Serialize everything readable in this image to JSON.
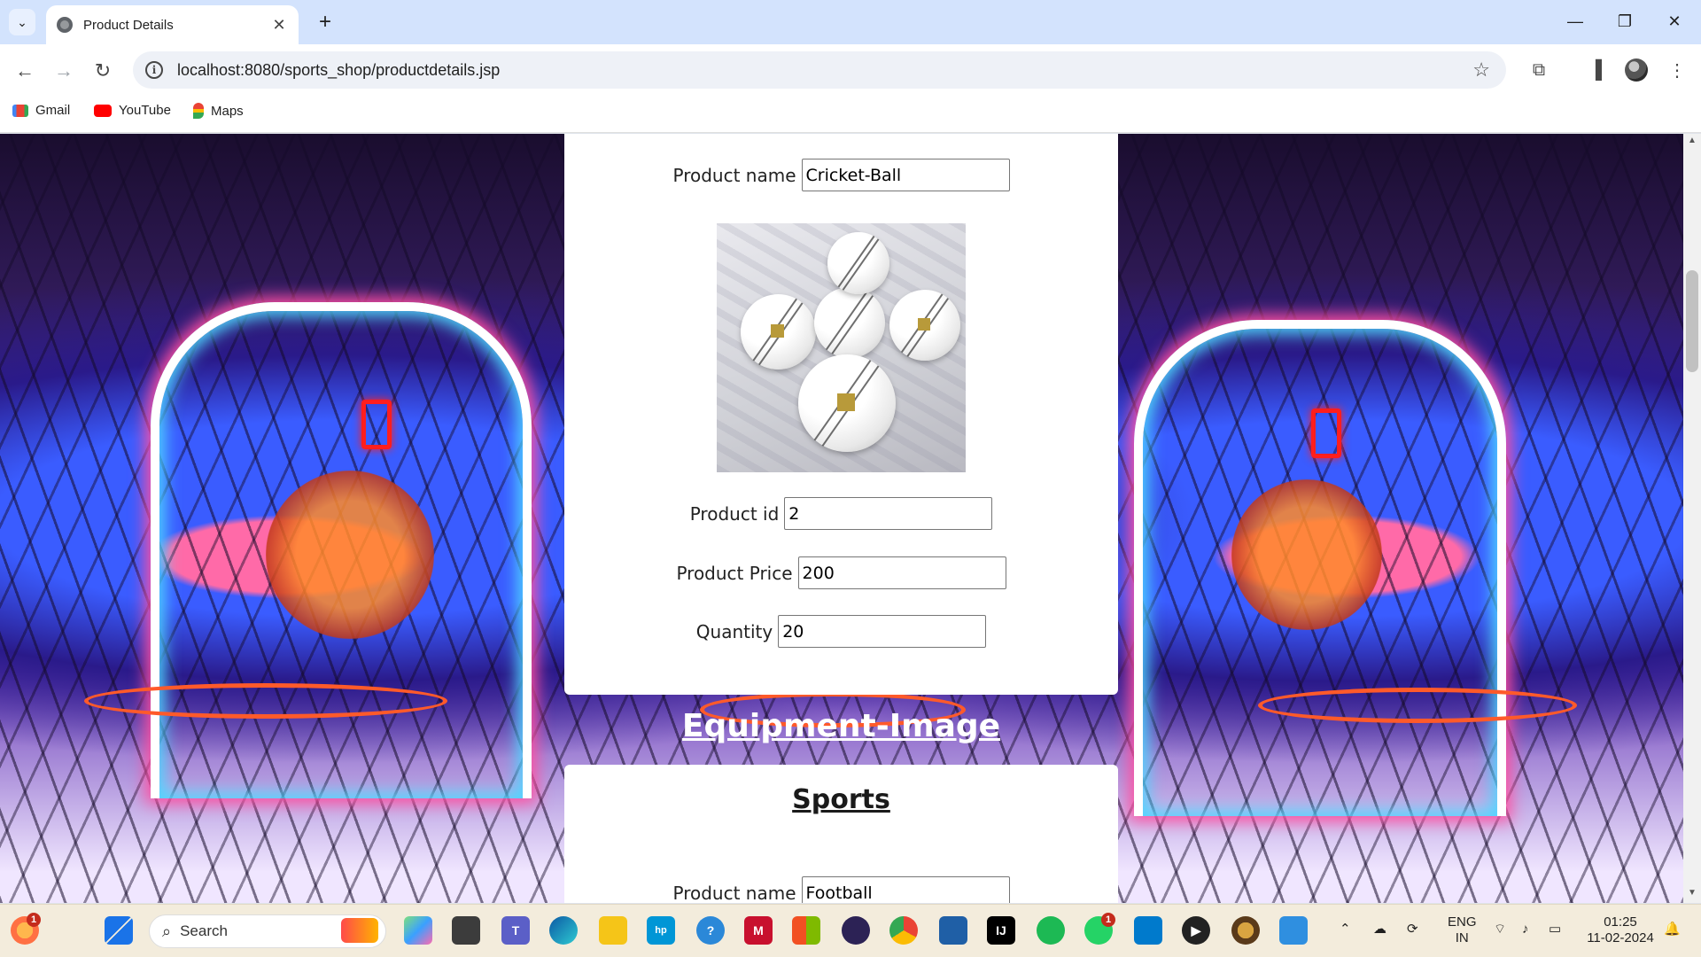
{
  "browser": {
    "tab_title": "Product Details",
    "url": "localhost:8080/sports_shop/productdetails.jsp",
    "new_tab_label": "+",
    "close_tab_label": "✕"
  },
  "bookmarks": [
    {
      "label": "Gmail",
      "icon": "gmail-icon",
      "color": "#ea4335"
    },
    {
      "label": "YouTube",
      "icon": "youtube-icon",
      "color": "#ff0000"
    },
    {
      "label": "Maps",
      "icon": "maps-icon",
      "color": "#34a853"
    }
  ],
  "product1": {
    "name_label": "Product name",
    "name_value": "Cricket-Ball",
    "id_label": "Product id",
    "id_value": "2",
    "price_label": "Product Price",
    "price_value": "200",
    "quantity_label": "Quantity",
    "quantity_value": "20"
  },
  "section": {
    "equipment_heading": "Equipment-Image",
    "sports_heading": "Sports"
  },
  "product2": {
    "name_label": "Product name",
    "name_value": "Football"
  },
  "taskbar": {
    "search_placeholder": "Search",
    "lang_line1": "ENG",
    "lang_line2": "IN",
    "time": "01:25",
    "date": "11-02-2024",
    "weather_badge": "1",
    "whatsapp_badge": "1"
  },
  "colors": {
    "titlebar": "#d3e3fd",
    "card": "#ffffff",
    "taskbar": "#f3ecdc"
  }
}
